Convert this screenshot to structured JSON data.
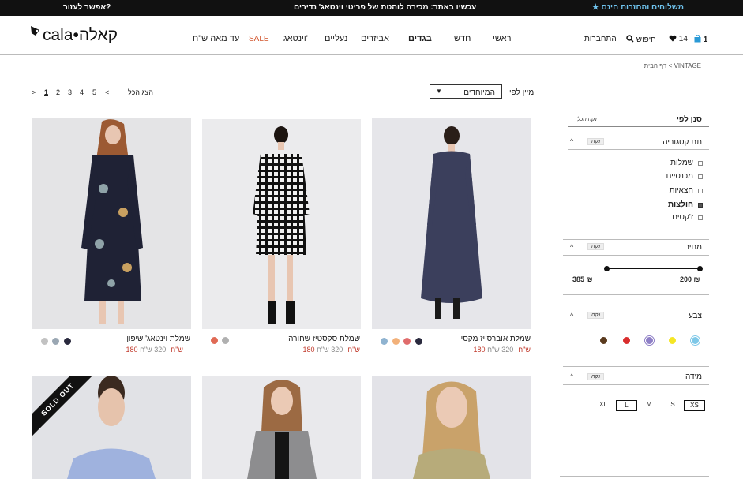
{
  "topbar": {
    "shipping": "★ משלוחים והחזרות חינם",
    "promo": "עכשיו באתר: מכירה לוהטת של פריטי וינטאג' נדירים",
    "help": "אפשר לעזור?"
  },
  "logo": {
    "text": "cala•קאלה"
  },
  "nav": {
    "home": "ראשי",
    "new": "חדש",
    "clothes": "בגדים",
    "accessories": "אביזרים",
    "shoes": "נעליים",
    "vintage": "וינטאג'",
    "sale": "SALE",
    "under100": "עד מאה ש\"ח"
  },
  "utility": {
    "cart_count": "1",
    "wishlist_count": "14",
    "search": "חיפוש",
    "login": "התחברות"
  },
  "breadcrumb": "דף הבית  <  VINTAGE",
  "sort": {
    "label": "מיין לפי",
    "value": "המיוחדים",
    "show_all": "הצג הכל",
    "pages": [
      "1",
      "2",
      "3",
      "4",
      "5"
    ],
    "prev": "<",
    "next": ">"
  },
  "products": [
    {
      "title": "שמלת אוברסייז מקסי",
      "price": "180 ש\"ח",
      "old_price": "320 ש\"ח",
      "colors": [
        "#2a2a3e",
        "#e06c6c",
        "#f2b17a",
        "#8fb3d0"
      ]
    },
    {
      "title": "שמלת סקסטיז שחורה",
      "price": "180 ש\"ח",
      "old_price": "320 ש\"ח",
      "colors": [
        "#b0b0b0",
        "#e06a55"
      ]
    },
    {
      "title": "שמלת וינטאג' שיפון",
      "price": "180 ש\"ח",
      "old_price": "320 ש\"ח",
      "colors": [
        "#2a2a3e",
        "#9aa7b3",
        "#c2c2c2"
      ]
    },
    {
      "sold_out": "SOLD OUT"
    }
  ],
  "filters": {
    "title": "סנן לפי",
    "clear_all": "נקה הכל",
    "clear": "נקה",
    "subcategory": {
      "title": "תת קטגוריה",
      "items": [
        "שמלות",
        "מכנסיים",
        "חצאיות",
        "חולצות",
        "ז'קטים"
      ],
      "selected_index": 3
    },
    "price": {
      "title": "מחיר",
      "min": "200 ₪",
      "max": "385 ₪"
    },
    "color": {
      "title": "צבע",
      "swatches": [
        "#7ec8e8",
        "#f5e625",
        "#8e7fc6",
        "#d92d2d",
        "#5a3a1e"
      ]
    },
    "size": {
      "title": "מידה",
      "options": [
        "XS",
        "S",
        "M",
        "L",
        "XL"
      ],
      "selected": [
        "XS",
        "L"
      ]
    }
  }
}
